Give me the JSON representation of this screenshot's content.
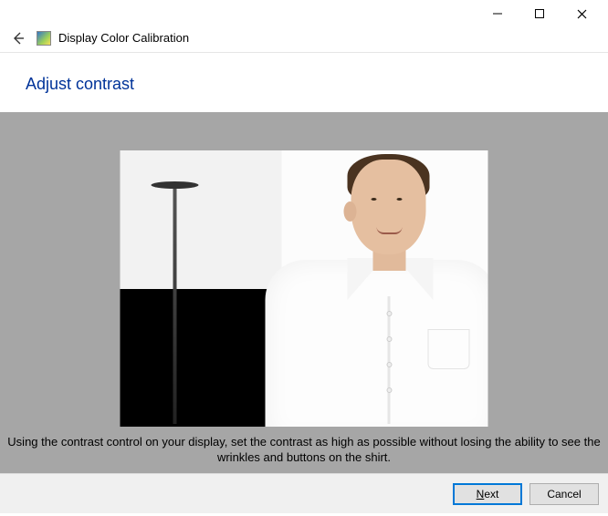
{
  "window": {
    "app_title": "Display Color Calibration"
  },
  "page": {
    "heading": "Adjust contrast",
    "instruction": "Using the contrast control on your display, set the contrast as high as possible without losing the ability to see the wrinkles and buttons on the shirt."
  },
  "buttons": {
    "next": "Next",
    "cancel": "Cancel"
  }
}
